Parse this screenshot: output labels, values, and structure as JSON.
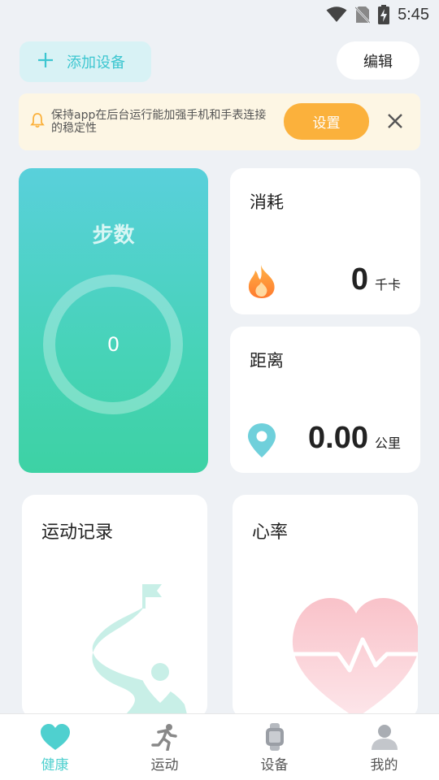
{
  "status_bar": {
    "time": "5:45",
    "icons": [
      "wifi-icon",
      "no-sim-icon",
      "battery-charging-icon"
    ]
  },
  "header": {
    "add_device_label": "添加设备",
    "edit_label": "编辑"
  },
  "notice": {
    "text": "保持app在后台运行能加强手机和手表连接的稳定性",
    "settings_label": "设置",
    "icon": "bell-icon"
  },
  "steps": {
    "title": "步数",
    "value": "0"
  },
  "calories": {
    "title": "消耗",
    "value": "0",
    "unit": "千卡",
    "icon": "flame-icon"
  },
  "distance": {
    "title": "距离",
    "value": "0.00",
    "unit": "公里",
    "icon": "location-pin-icon"
  },
  "exercise_record": {
    "title": "运动记录"
  },
  "heart_rate": {
    "title": "心率"
  },
  "tabs": [
    {
      "label": "健康",
      "icon": "heart-icon",
      "active": true
    },
    {
      "label": "运动",
      "icon": "running-icon",
      "active": false
    },
    {
      "label": "设备",
      "icon": "watch-icon",
      "active": false
    },
    {
      "label": "我的",
      "icon": "user-icon",
      "active": false
    }
  ],
  "colors": {
    "accent": "#4fd0cf",
    "warning": "#fbb13c",
    "background": "#eef1f5"
  }
}
